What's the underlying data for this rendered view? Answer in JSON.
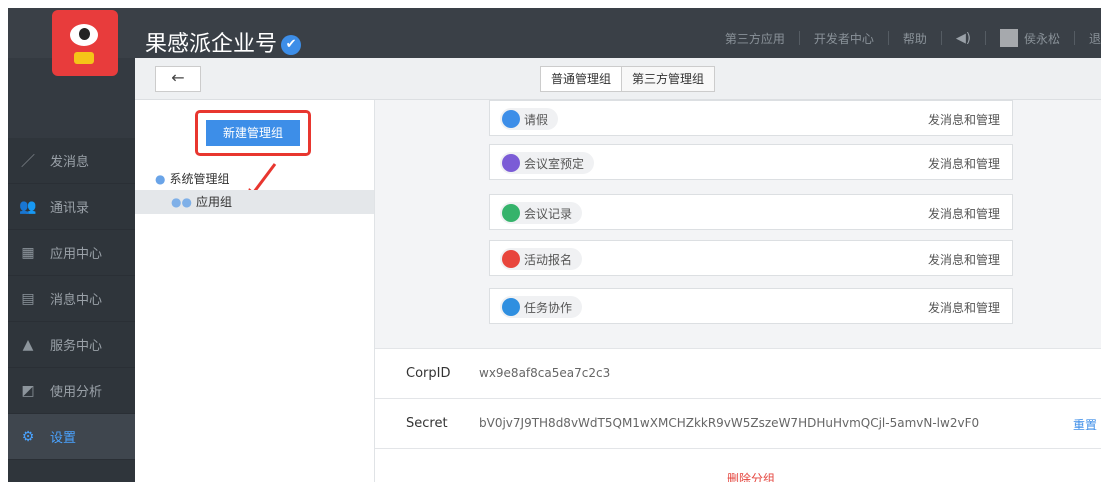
{
  "header": {
    "brand": "果感派企业号",
    "verified_mark": "✔",
    "nav": [
      "第三方应用",
      "开发者中心",
      "帮助"
    ],
    "user_name": "侯永松",
    "logout_fragment": "退"
  },
  "sidebar": {
    "items": [
      {
        "label": "发消息",
        "icon": "pencil-icon",
        "glyph": "／"
      },
      {
        "label": "通讯录",
        "icon": "contacts-icon",
        "glyph": "👥"
      },
      {
        "label": "应用中心",
        "icon": "apps-icon",
        "glyph": "▦"
      },
      {
        "label": "消息中心",
        "icon": "message-icon",
        "glyph": "▤"
      },
      {
        "label": "服务中心",
        "icon": "bell-service-icon",
        "glyph": "▲"
      },
      {
        "label": "使用分析",
        "icon": "analytics-icon",
        "glyph": "◩"
      },
      {
        "label": "设置",
        "icon": "gear-icon",
        "glyph": "⚙"
      }
    ]
  },
  "toolbar": {
    "back_glyph": "←",
    "tabs": [
      "普通管理组",
      "第三方管理组"
    ]
  },
  "groups": {
    "new_button": "新建管理组",
    "root": "系统管理组",
    "child": "应用组"
  },
  "apps": [
    {
      "name": "请假",
      "perm": "发消息和管理",
      "color": "#3d8ee8"
    },
    {
      "name": "会议室预定",
      "perm": "发消息和管理",
      "color": "#7b5cd6"
    },
    {
      "name": "会议记录",
      "perm": "发消息和管理",
      "color": "#35b36b"
    },
    {
      "name": "活动报名",
      "perm": "发消息和管理",
      "color": "#e8453c"
    },
    {
      "name": "任务协作",
      "perm": "发消息和管理",
      "color": "#2f8fe0"
    }
  ],
  "credentials": {
    "corpid_label": "CorpID",
    "corpid_value": "wx9e8af8ca5ea7c2c3",
    "secret_label": "Secret",
    "secret_value": "bV0jv7J9TH8d8vWdT5QM1wXMCHZkkR9vW5ZszeW7HDHuHvmQCjl-5amvN-lw2vF0",
    "reset_label": "重置"
  },
  "delete_label": "删除分组",
  "colors": {
    "accent": "#3d8ee8",
    "danger": "#e5463f",
    "highlight_box": "#e8362f"
  }
}
